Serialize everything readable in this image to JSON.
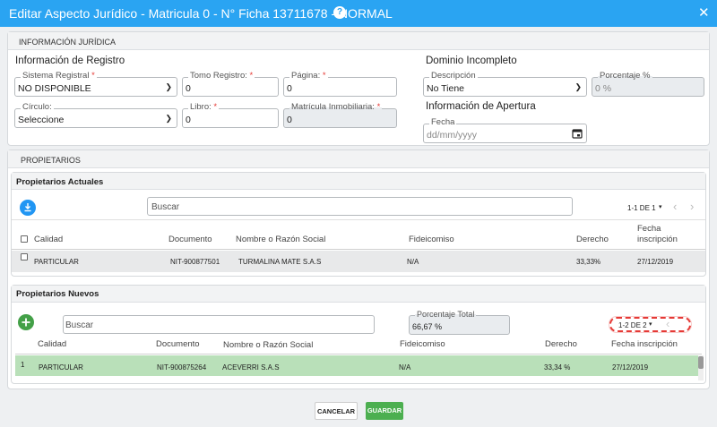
{
  "dialog": {
    "title": "Editar Aspecto Jurídico - Matricula 0 - N° Ficha 13711678 - NORMAL",
    "help_glyph": "?",
    "close_glyph": "✕"
  },
  "juridica": {
    "section_title": "INFORMACIÓN JURÍDICA",
    "registro_heading": "Información de Registro",
    "sistema_label": "Sistema Registral",
    "sistema_value": "NO DISPONIBLE",
    "tomo_label": "Tomo Registro:",
    "tomo_value": "0",
    "pagina_label": "Página:",
    "pagina_value": "0",
    "circulo_label": "Círculo:",
    "circulo_value": "Seleccione",
    "libro_label": "Libro:",
    "libro_value": "0",
    "matricula_label": "Matrícula Inmobiliaria:",
    "matricula_value": "0",
    "required_mark": "*",
    "dominio_heading": "Dominio Incompleto",
    "descripcion_label": "Descripción",
    "descripcion_value": "No Tiene",
    "porcentaje_label": "Porcentaje %",
    "porcentaje_value": "0 %",
    "apertura_heading": "Información de Apertura",
    "fecha_label": "Fecha",
    "fecha_placeholder": "dd/mm/yyyy"
  },
  "propietarios": {
    "section_title": "PROPIETARIOS",
    "actuales": {
      "title": "Propietarios Actuales",
      "search_placeholder": "Buscar",
      "pagination": "1-1 DE 1",
      "columns": {
        "calidad": "Calidad",
        "documento": "Documento",
        "nombre": "Nombre o Razón Social",
        "fideicomiso": "Fideicomiso",
        "derecho": "Derecho",
        "fecha_l1": "Fecha",
        "fecha_l2": "inscripción"
      },
      "rows": [
        {
          "calidad": "PARTICULAR",
          "documento": "NIT-900877501",
          "nombre": "TURMALINA MATE S.A.S",
          "fideicomiso": "N/A",
          "derecho": "33,33%",
          "fecha": "27/12/2019"
        }
      ]
    },
    "nuevos": {
      "title": "Propietarios Nuevos",
      "search_placeholder": "Buscar",
      "porcentaje_label": "Porcentaje Total",
      "porcentaje_value": "66,67 %",
      "pagination": "1-2 DE 2",
      "columns": {
        "calidad": "Calidad",
        "documento": "Documento",
        "nombre": "Nombre o Razón Social",
        "fideicomiso": "Fideicomiso",
        "derecho": "Derecho",
        "fecha": "Fecha inscripción"
      },
      "rows": [
        {
          "index": "1",
          "calidad": "PARTICULAR",
          "documento": "NIT-900875264",
          "nombre": "ACEVERRI S.A.S",
          "fideicomiso": "N/A",
          "derecho": "33,34 %",
          "fecha": "27/12/2019"
        }
      ]
    }
  },
  "footer": {
    "cancel_label": "CANCELAR",
    "save_label": "GUARDAR"
  },
  "colors": {
    "header": "#2aa4f2",
    "accent": "#2196f3",
    "save": "#4caf50",
    "selected_row": "#b9e0b9",
    "highlight": "#e53935"
  }
}
